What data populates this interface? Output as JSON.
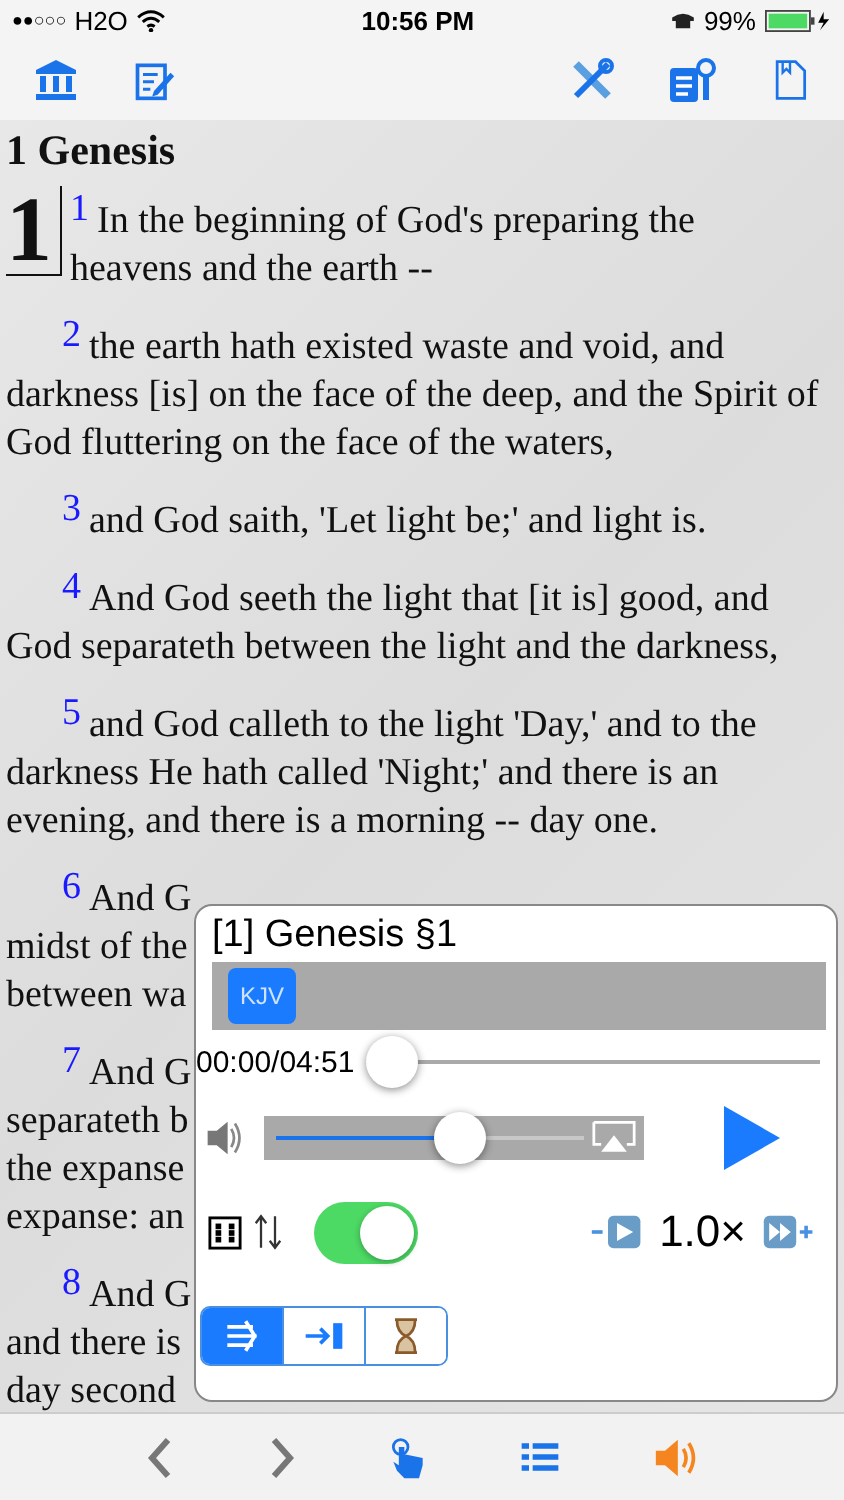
{
  "status_bar": {
    "signal": "●●○○○",
    "carrier": "H2O",
    "time": "10:56 PM",
    "battery": "99%"
  },
  "title": "1 Genesis",
  "chapter_number": "1",
  "verses": [
    {
      "kind": "full",
      "number": "1",
      "text": "In the beginning of God's preparing the heavens and the earth --"
    },
    {
      "kind": "full",
      "number": "2",
      "text": "the earth hath existed waste and void, and darkness [is] on the face of the deep, and the Spirit of God fluttering on the face of the waters,"
    },
    {
      "kind": "full",
      "number": "3",
      "text": "and God saith, 'Let light be;' and light is."
    },
    {
      "kind": "full",
      "number": "4",
      "text": "And God seeth the light that [it is] good, and God separateth between the light and the darkness,"
    },
    {
      "kind": "full",
      "number": "5",
      "text": "and God calleth to the light 'Day,' and to the darkness He hath called 'Night;' and there is an evening, and there is a morning -- day one."
    },
    {
      "kind": "partial",
      "number": "6",
      "lines": [
        "And G",
        "midst of the",
        "between wa"
      ]
    },
    {
      "kind": "partial",
      "number": "7",
      "lines": [
        "And G",
        "separateth b",
        "the expanse",
        "expanse: an"
      ]
    },
    {
      "kind": "partial",
      "number": "8",
      "lines": [
        "And G",
        "and there is",
        "day second"
      ]
    }
  ],
  "player": {
    "title": "[1] Genesis §1",
    "versions": [
      {
        "label": "KJV",
        "selected": true
      }
    ],
    "time": "00:00/04:51",
    "progress": {
      "level": 0.0
    },
    "volume": {
      "level": 0.6
    },
    "auto_scroll": {
      "on": true
    },
    "speed": "1.0×",
    "modes": [
      {
        "kind": "continuous",
        "selected": true
      },
      {
        "kind": "stop-end",
        "selected": false
      },
      {
        "kind": "timer",
        "selected": false
      }
    ]
  }
}
